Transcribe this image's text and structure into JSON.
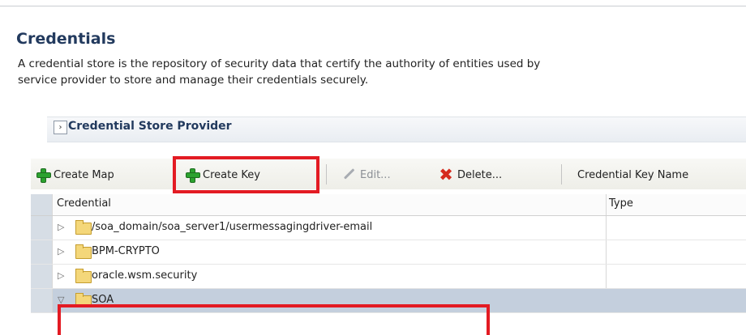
{
  "page": {
    "title": "Credentials",
    "description_line1": "A credential store is the repository of security data that certify the authority of entities used by",
    "description_line2": "service provider to store and manage their credentials securely."
  },
  "section": {
    "title": "Credential Store Provider",
    "disclosure_icon": "chevron-right-icon"
  },
  "toolbar": {
    "create_map": "Create Map",
    "create_key": "Create Key",
    "edit": "Edit...",
    "delete": "Delete...",
    "credential_key_name": "Credential Key Name",
    "highlight_color": "#e31b23"
  },
  "table": {
    "columns": [
      "Credential",
      "Type"
    ],
    "rows": [
      {
        "label": "/soa_domain/soa_server1/usermessagingdriver-email",
        "expanded": false
      },
      {
        "label": "BPM-CRYPTO",
        "expanded": false
      },
      {
        "label": "oracle.wsm.security",
        "expanded": false
      },
      {
        "label": "SOA",
        "expanded": true
      }
    ]
  }
}
